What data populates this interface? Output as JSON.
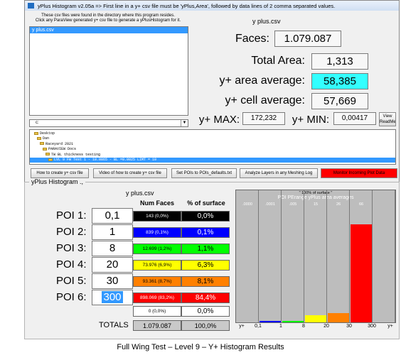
{
  "window": {
    "title": "yPlus Histogram v2.05a => First line in a y+ csv file must be 'yPlus,Area', followed by data lines of 2 comma separated values."
  },
  "file_panel": {
    "info_line1": "These csv files were found in the directory where this program resides.",
    "info_line2": "Click any ParaView generated y+ csv file to generate a yPlusHistogram for it.",
    "files": [
      "y plus.csv"
    ],
    "drive": "c:"
  },
  "stats": {
    "file_name": "y plus.csv",
    "faces_label": "Faces:",
    "faces_value": "1.079.087",
    "total_area_label": "Total Area:",
    "total_area_value": "1,313",
    "area_avg_label": "y+ area average:",
    "area_avg_value": "58,385",
    "cell_avg_label": "y+ cell average:",
    "cell_avg_value": "57,669",
    "max_label": "y+ MAX:",
    "max_value": "172,232",
    "min_label": "y+ MIN:",
    "min_value": "0,00417",
    "view_btn_line1": "View",
    "view_btn_line2": "ReadMe"
  },
  "tree": {
    "items": [
      "Desktop",
      "Dan",
      "Raceyard 2021",
      "PARAVIEW Docs",
      "TW BL thickness testing",
      "LVL 9 FW Test 1 - 18.0865 - BL =0.0025 LIMT = 10"
    ]
  },
  "buttons": {
    "how_csv": "How to create y+ csv file",
    "video_csv": "Video of how to create y+ csv file",
    "set_pois": "Set POIs to POIs_defaults.txt",
    "analyze": "Analyze Layers in any Meshing Log",
    "monitor": "Monitor Incoming Plot Data"
  },
  "histogram": {
    "group_title": "yPlus Histogram .,",
    "file_name": "y plus.csv",
    "col_num_faces": "Num Faces",
    "col_pct": "% of surface",
    "totals_label": "TOTALS",
    "totals_faces": "1.079.087",
    "totals_pct": "100,0%",
    "rows": [
      {
        "label": "POI 1:",
        "value": "0,1",
        "count": "143 (0,0%)",
        "pct": "0,0%",
        "color": "#000000",
        "text": "#ffffff"
      },
      {
        "label": "POI 2:",
        "value": "1",
        "count": "839 (0,1%)",
        "pct": "0,1%",
        "color": "#0000ff",
        "text": "#ffffff"
      },
      {
        "label": "POI 3:",
        "value": "8",
        "count": "12.699 (1,2%)",
        "pct": "1,1%",
        "color": "#00ff00",
        "text": "#000000"
      },
      {
        "label": "POI 4:",
        "value": "20",
        "count": "73.976 (6,9%)",
        "pct": "6,3%",
        "color": "#ffff00",
        "text": "#000000"
      },
      {
        "label": "POI 5:",
        "value": "30",
        "count": "93.361 (8,7%)",
        "pct": "8,1%",
        "color": "#ff8000",
        "text": "#000000"
      },
      {
        "label": "POI 6:",
        "value": "300",
        "count": "898.069 (83,2%)",
        "pct": "84,4%",
        "color": "#ff0000",
        "text": "#ffffff"
      }
    ],
    "overflow_count": "0 (0,0%)",
    "overflow_pct": "0,0%"
  },
  "chart_data": {
    "type": "bar",
    "title": "POI PErange yPlus area averages",
    "scale_note": "\" 100% of surface \"",
    "top_labels": [
      ".0000",
      ".0001",
      ".005",
      "15",
      "26",
      "66"
    ],
    "categories": [
      "y+ < 0,1",
      "0,1-1",
      "1-8",
      "8-20",
      "20-30",
      "30-300",
      "> 300"
    ],
    "values": [
      0.0,
      0.1,
      1.1,
      6.3,
      8.1,
      84.4,
      0.0
    ],
    "colors": [
      "#000000",
      "#0000ff",
      "#00ff00",
      "#ffff00",
      "#ff8000",
      "#ff0000",
      "#bdbdbd"
    ],
    "x_tick_labels": [
      "y+",
      "0,1",
      "1",
      "8",
      "20",
      "30",
      "300",
      "y+"
    ],
    "ylim": [
      0,
      100
    ]
  },
  "caption": "Full Wing Test – Level 9 – Y+ Histogram Results"
}
